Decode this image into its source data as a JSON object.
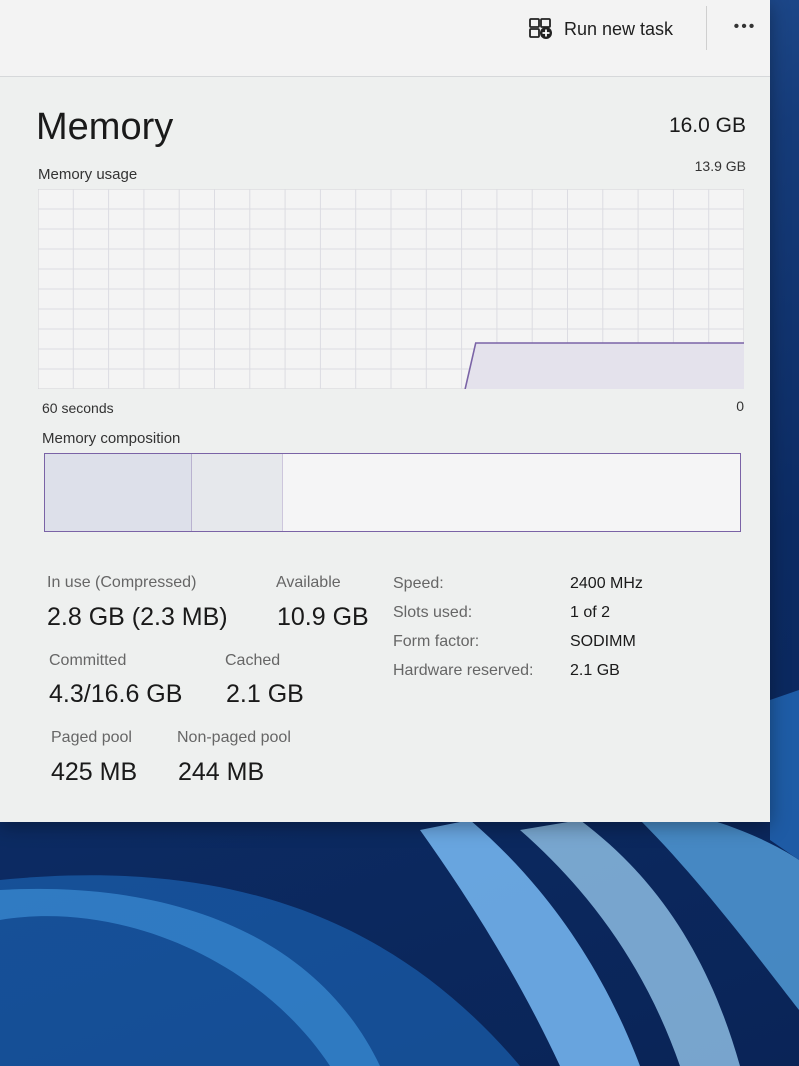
{
  "header": {
    "run_new_task_label": "Run new task",
    "more_label": "•••"
  },
  "page": {
    "title": "Memory",
    "total": "16.0 GB"
  },
  "usage_graph": {
    "label": "Memory usage",
    "max_label": "13.9 GB",
    "time_label": "60 seconds",
    "min_label": "0",
    "line_color": "#7a63a6",
    "fill_color": "#e4e2ec"
  },
  "composition": {
    "label": "Memory composition",
    "segments": [
      {
        "name": "in-use",
        "fraction": 0.21
      },
      {
        "name": "modified",
        "fraction": 0.13
      }
    ]
  },
  "stats": {
    "in_use_label": "In use (Compressed)",
    "in_use_value": "2.8 GB (2.3 MB)",
    "available_label": "Available",
    "available_value": "10.9 GB",
    "committed_label": "Committed",
    "committed_value": "4.3/16.6 GB",
    "cached_label": "Cached",
    "cached_value": "2.1 GB",
    "paged_pool_label": "Paged pool",
    "paged_pool_value": "425 MB",
    "non_paged_pool_label": "Non-paged pool",
    "non_paged_pool_value": "244 MB"
  },
  "details": {
    "speed_label": "Speed:",
    "speed_value": "2400 MHz",
    "slots_label": "Slots used:",
    "slots_value": "1 of 2",
    "form_factor_label": "Form factor:",
    "form_factor_value": "SODIMM",
    "hw_reserved_label": "Hardware reserved:",
    "hw_reserved_value": "2.1 GB"
  }
}
